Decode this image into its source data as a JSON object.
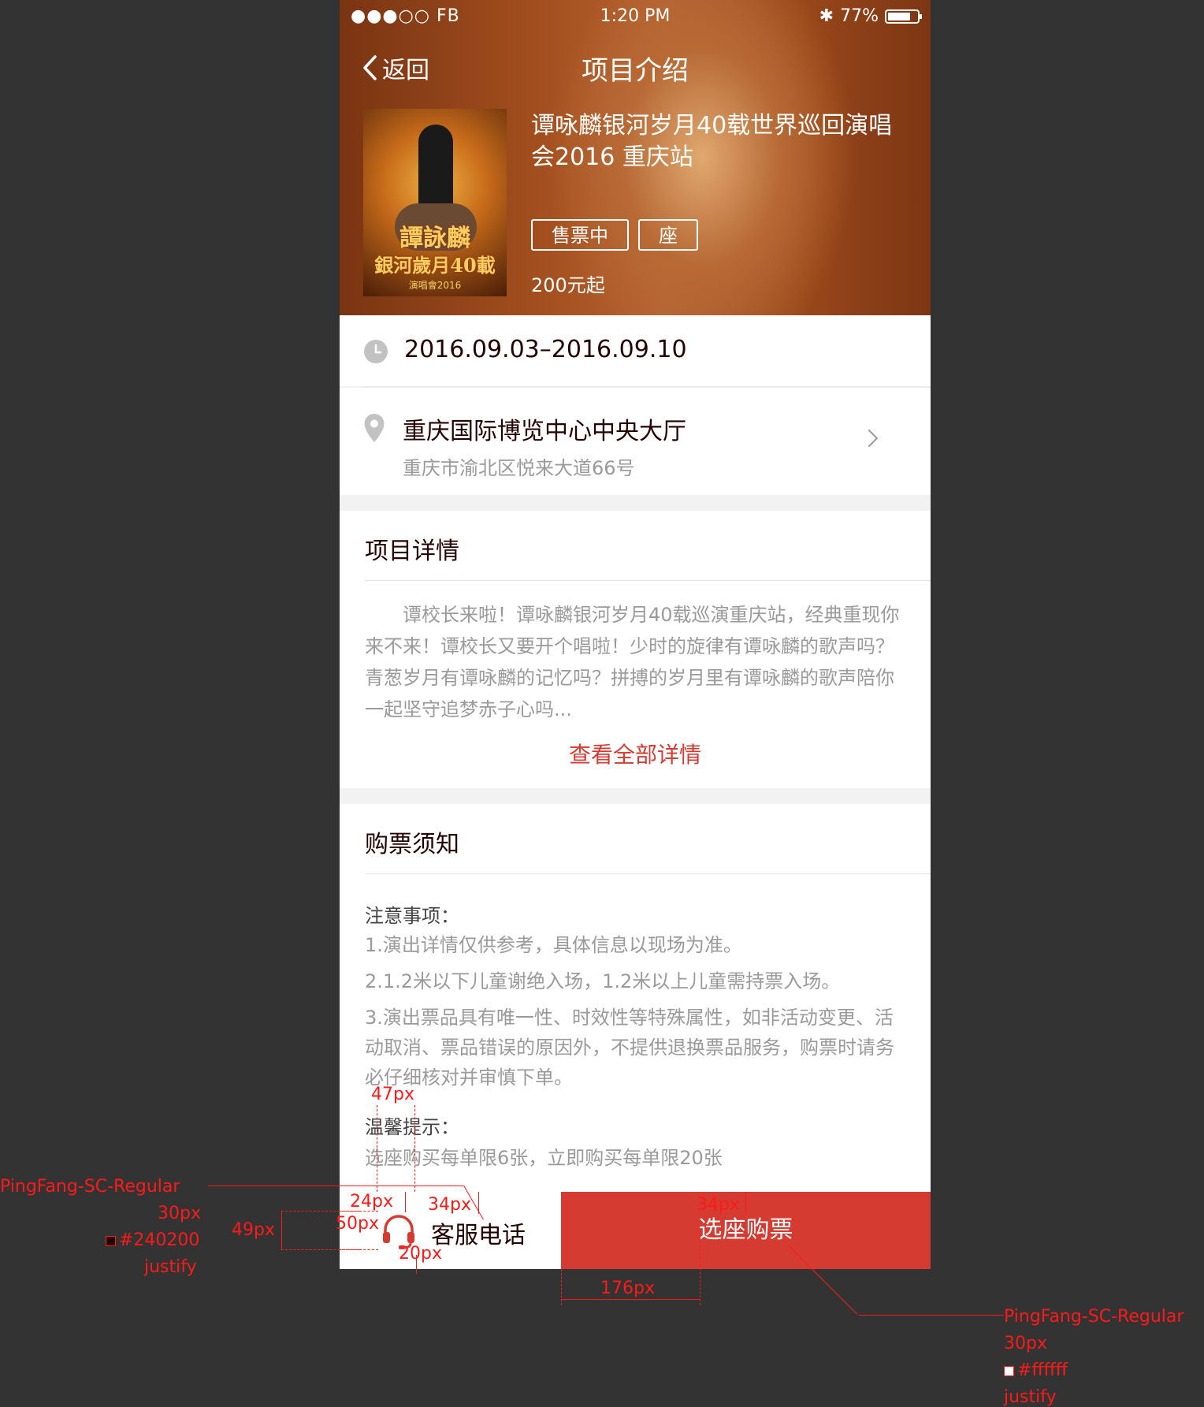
{
  "status_bar": {
    "carrier": "●●●○○ FB",
    "time": "1:20 PM",
    "battery": "77%",
    "battery_level": 0.77
  },
  "nav": {
    "back_label": "返回",
    "title": "项目介绍"
  },
  "poster": {
    "line1": "譚詠麟",
    "line2": "銀河歲月40載",
    "sub": "演唱會2016"
  },
  "event": {
    "title": "谭咏麟银河岁月40载世界巡回演唱会2016 重庆站",
    "tags": [
      "售票中",
      "座"
    ],
    "price": "200元起"
  },
  "schedule": {
    "date_range": "2016.09.03–2016.09.10"
  },
  "venue": {
    "name": "重庆国际博览中心中央大厅",
    "address": "重庆市渝北区悦来大道66号"
  },
  "detail": {
    "title": "项目详情",
    "text": "谭校长来啦！谭咏麟银河岁月40载巡演重庆站，经典重现你来不来！谭校长又要开个唱啦！少时的旋律有谭咏麟的歌声吗？青葱岁月有谭咏麟的记忆吗？拼搏的岁月里有谭咏麟的歌声陪你一起坚守追梦赤子心吗...",
    "more_label": "查看全部详情"
  },
  "notice": {
    "title": "购票须知",
    "caution_title": "注意事项：",
    "items": [
      "1.演出详情仅供参考，具体信息以现场为准。",
      "2.1.2米以下儿童谢绝入场，1.2米以上儿童需持票入场。",
      "3.演出票品具有唯一性、时效性等特殊属性，如非活动变更、活动取消、票品错误的原因外，不提供退换票品服务，购票时请务必仔细核对并审慎下单。"
    ],
    "tip_title": "温馨提示：",
    "tip_text": "选座购买每单限6张，立即购买每单限20张"
  },
  "bottom_bar": {
    "service_label": "客服电话",
    "buy_label": "选座购票"
  },
  "annotations": {
    "spacing": [
      "47px",
      "24px",
      "34px",
      "50px",
      "49px",
      "20px",
      "34px",
      "176px"
    ],
    "left_spec": {
      "font": "PingFang-SC-Regular",
      "size": "30px",
      "color": "#240200",
      "align": "justify"
    },
    "right_spec": {
      "font": "PingFang-SC-Regular",
      "size": "30px",
      "color": "#ffffff",
      "align": "justify"
    }
  },
  "colors": {
    "accent": "#d63b32",
    "text_dark": "#240200",
    "text_gray": "#9a9a9a",
    "background": "#333333"
  }
}
